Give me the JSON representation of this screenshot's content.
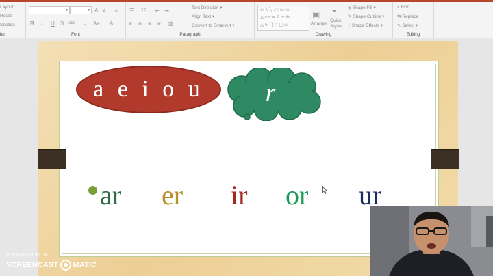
{
  "ribbon": {
    "slides_group": {
      "layout_label": "Layout",
      "reset_label": "Reset",
      "section_label": "Section",
      "group_label": "les"
    },
    "font_group": {
      "group_label": "Font",
      "size_up": "A",
      "size_down": "A",
      "bold": "B",
      "italic": "I",
      "underline": "U",
      "strike": "S",
      "abc": "abc",
      "font_color": "A"
    },
    "paragraph_group": {
      "group_label": "Paragraph",
      "text_direction": "Text Direction",
      "align_text": "Align Text",
      "smartart": "Convert to SmartArt"
    },
    "drawing_group": {
      "group_label": "Drawing",
      "arrange": "Arrange",
      "quick_styles": "Quick Styles",
      "shape_fill": "Shape Fill",
      "shape_outline": "Shape Outline",
      "shape_effects": "Shape Effects"
    },
    "editing_group": {
      "group_label": "Editing",
      "find": "Find",
      "replace": "Replace",
      "select": "Select"
    }
  },
  "slide": {
    "vowels": "a e i o u",
    "cloud_letter": "r",
    "words": [
      {
        "text": "ar",
        "color": "#2f6b44"
      },
      {
        "text": "er",
        "color": "#b8912f"
      },
      {
        "text": "ir",
        "color": "#a32a22"
      },
      {
        "text": "or",
        "color": "#1f9a55"
      },
      {
        "text": "ur",
        "color": "#1a2b5e"
      }
    ],
    "accent_colors": {
      "oval": "#b23a2c",
      "cloud": "#2f8a63",
      "bullet": "#78a03a",
      "rule": "#8fa44f"
    }
  },
  "watermark": {
    "line1": "RECORDED WITH",
    "brand_left": "SCREENCAST",
    "brand_right": "MATIC"
  }
}
